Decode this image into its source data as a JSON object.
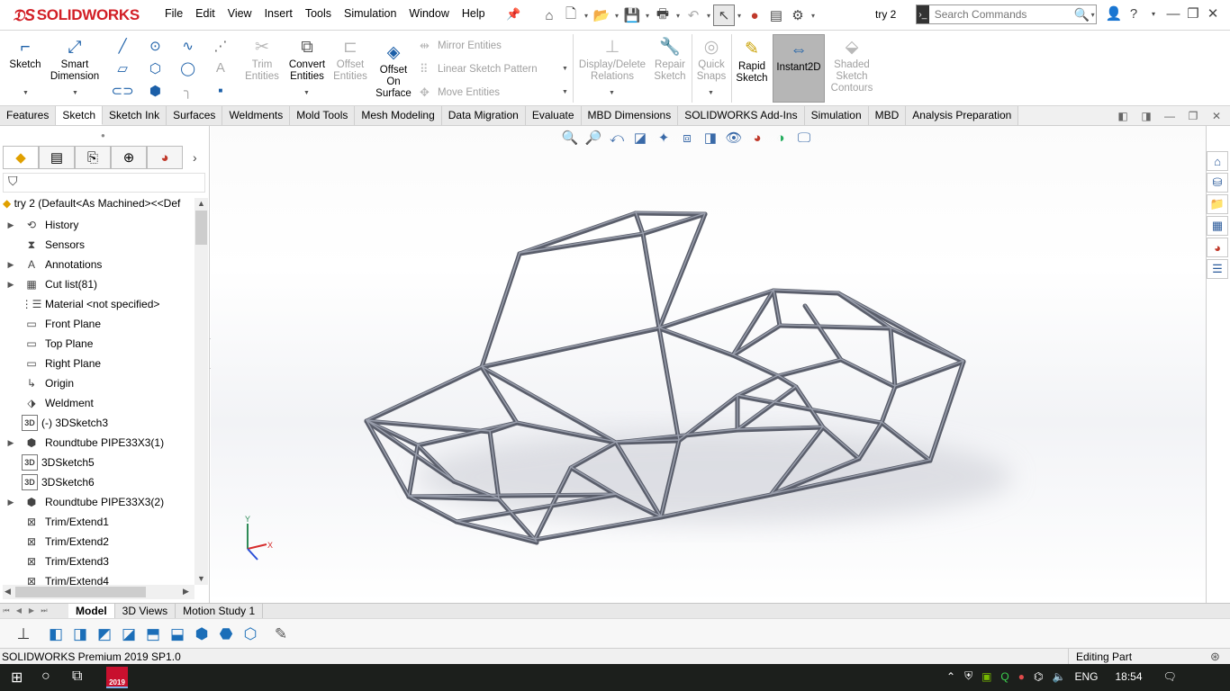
{
  "app": {
    "brand": "SOLIDWORKS",
    "doc_title": "try 2"
  },
  "menu": [
    "File",
    "Edit",
    "View",
    "Insert",
    "Tools",
    "Simulation",
    "Window",
    "Help"
  ],
  "search": {
    "placeholder": "Search Commands"
  },
  "tools": {
    "sketch": "Sketch",
    "smart_dim_1": "Smart",
    "smart_dim_2": "Dimension",
    "trim_1": "Trim",
    "trim_2": "Entities",
    "convert_1": "Convert",
    "convert_2": "Entities",
    "offset_1": "Offset",
    "offset_2": "Entities",
    "offset_surf_1": "Offset",
    "offset_surf_2": "On",
    "offset_surf_3": "Surface",
    "mirror": "Mirror Entities",
    "linear_pattern": "Linear Sketch Pattern",
    "move": "Move Entities",
    "display_rel_1": "Display/Delete",
    "display_rel_2": "Relations",
    "repair_1": "Repair",
    "repair_2": "Sketch",
    "quick_1": "Quick",
    "quick_2": "Snaps",
    "rapid_1": "Rapid",
    "rapid_2": "Sketch",
    "instant2d": "Instant2D",
    "shaded_1": "Shaded",
    "shaded_2": "Sketch",
    "shaded_3": "Contours"
  },
  "tabs": [
    "Features",
    "Sketch",
    "Sketch Ink",
    "Surfaces",
    "Weldments",
    "Mold Tools",
    "Mesh Modeling",
    "Data Migration",
    "Evaluate",
    "MBD Dimensions",
    "SOLIDWORKS Add-Ins",
    "Simulation",
    "MBD",
    "Analysis Preparation"
  ],
  "active_tab": "Sketch",
  "tree": {
    "root": "try 2  (Default<As Machined><<Def",
    "items": [
      {
        "label": "History",
        "expand": true,
        "icon": "history-icon"
      },
      {
        "label": "Sensors",
        "expand": false,
        "icon": "sensors-icon"
      },
      {
        "label": "Annotations",
        "expand": true,
        "icon": "annotations-icon"
      },
      {
        "label": "Cut list(81)",
        "expand": true,
        "icon": "cutlist-icon"
      },
      {
        "label": "Material <not specified>",
        "expand": false,
        "icon": "material-icon"
      },
      {
        "label": "Front Plane",
        "expand": false,
        "icon": "plane-icon"
      },
      {
        "label": "Top Plane",
        "expand": false,
        "icon": "plane-icon"
      },
      {
        "label": "Right Plane",
        "expand": false,
        "icon": "plane-icon"
      },
      {
        "label": "Origin",
        "expand": false,
        "icon": "origin-icon"
      },
      {
        "label": "Weldment",
        "expand": false,
        "icon": "weldment-icon"
      },
      {
        "label": "(-) 3DSketch3",
        "expand": false,
        "icon": "3dsketch-icon"
      },
      {
        "label": "Roundtube PIPE33X3(1)",
        "expand": true,
        "icon": "structural-member-icon"
      },
      {
        "label": "3DSketch5",
        "expand": false,
        "icon": "3dsketch-icon"
      },
      {
        "label": "3DSketch6",
        "expand": false,
        "icon": "3dsketch-icon"
      },
      {
        "label": "Roundtube PIPE33X3(2)",
        "expand": true,
        "icon": "structural-member-icon"
      },
      {
        "label": "Trim/Extend1",
        "expand": false,
        "icon": "trim-extend-icon"
      },
      {
        "label": "Trim/Extend2",
        "expand": false,
        "icon": "trim-extend-icon"
      },
      {
        "label": "Trim/Extend3",
        "expand": false,
        "icon": "trim-extend-icon"
      },
      {
        "label": "Trim/Extend4",
        "expand": false,
        "icon": "trim-extend-icon"
      }
    ]
  },
  "bottom_tabs": [
    "Model",
    "3D Views",
    "Motion Study 1"
  ],
  "status": {
    "version": "SOLIDWORKS Premium 2019 SP1.0",
    "mode": "Editing Part"
  },
  "taskbar": {
    "lang": "ENG",
    "time": "18:54",
    "sw_year": "2019"
  },
  "triad": {
    "x": "X",
    "y": "Y"
  },
  "colors": {
    "brand_red": "#d21f26",
    "accent_blue": "#1b5fa8",
    "tube": "#5a5e6b"
  }
}
